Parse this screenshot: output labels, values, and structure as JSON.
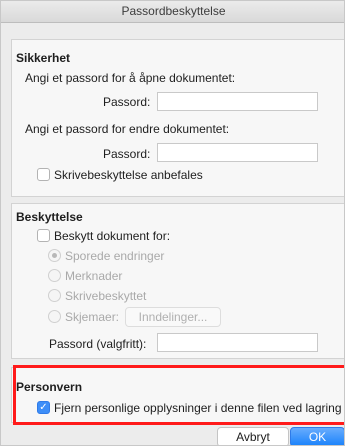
{
  "window": {
    "title": "Passordbeskyttelse"
  },
  "security": {
    "heading": "Sikkerhet",
    "open_prompt": "Angi et passord for å åpne dokumentet:",
    "open_password_label": "Passord:",
    "open_password_value": "",
    "modify_prompt": "Angi et passord for endre dokumentet:",
    "modify_password_label": "Passord:",
    "modify_password_value": "",
    "readonly_recommended_label": "Skrivebeskyttelse anbefales",
    "readonly_recommended_checked": false
  },
  "protection": {
    "heading": "Beskyttelse",
    "protect_label": "Beskytt dokument for:",
    "protect_checked": false,
    "options": [
      {
        "label": "Sporede endringer",
        "selected": true
      },
      {
        "label": "Merknader",
        "selected": false
      },
      {
        "label": "Skrivebeskyttet",
        "selected": false
      },
      {
        "label": "Skjemaer:",
        "selected": false
      }
    ],
    "sections_button": "Inndelinger...",
    "optional_password_label": "Passord (valgfritt):",
    "optional_password_value": ""
  },
  "privacy": {
    "heading": "Personvern",
    "remove_info_label": "Fjern personlige opplysninger i denne filen ved lagring",
    "remove_info_checked": true
  },
  "footer": {
    "cancel_label": "Avbryt",
    "ok_label": "OK"
  },
  "colors": {
    "accent": "#3d8ef8",
    "highlight": "#ff1a1a"
  }
}
